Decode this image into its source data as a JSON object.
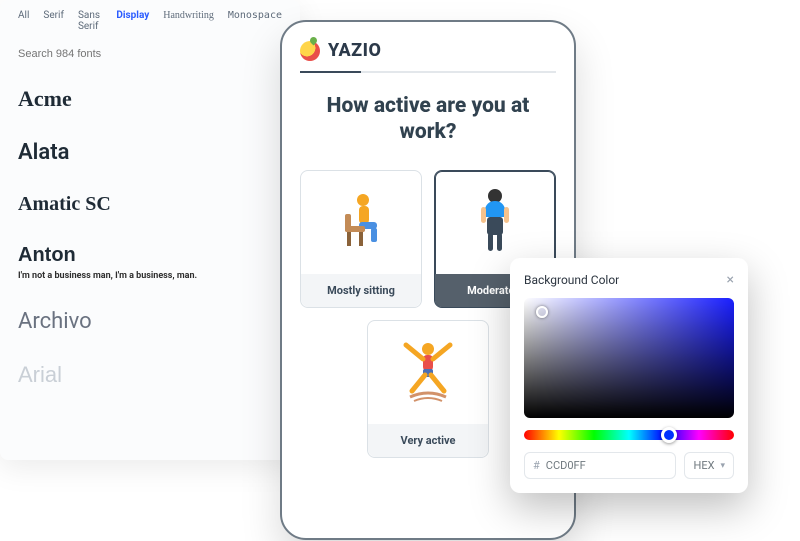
{
  "fontPanel": {
    "tabs": [
      "All",
      "Serif",
      "Sans Serif",
      "Display",
      "Handwriting",
      "Monospace"
    ],
    "activeTab": "Display",
    "searchPlaceholder": "Search 984 fonts",
    "fonts": [
      {
        "name": "Acme"
      },
      {
        "name": "Alata"
      },
      {
        "name": "Amatic SC"
      },
      {
        "name": "Anton",
        "preview": "I'm not a business man, I'm a business, man."
      },
      {
        "name": "Archivo"
      },
      {
        "name": "Arial"
      }
    ]
  },
  "phone": {
    "brand": "YAZIO",
    "question": "How active are you at work?",
    "options": [
      {
        "label": "Mostly sitting"
      },
      {
        "label": "Moderately"
      },
      {
        "label": "Very active"
      }
    ]
  },
  "picker": {
    "title": "Background Color",
    "hex": "CCD0FF",
    "format": "HEX"
  }
}
